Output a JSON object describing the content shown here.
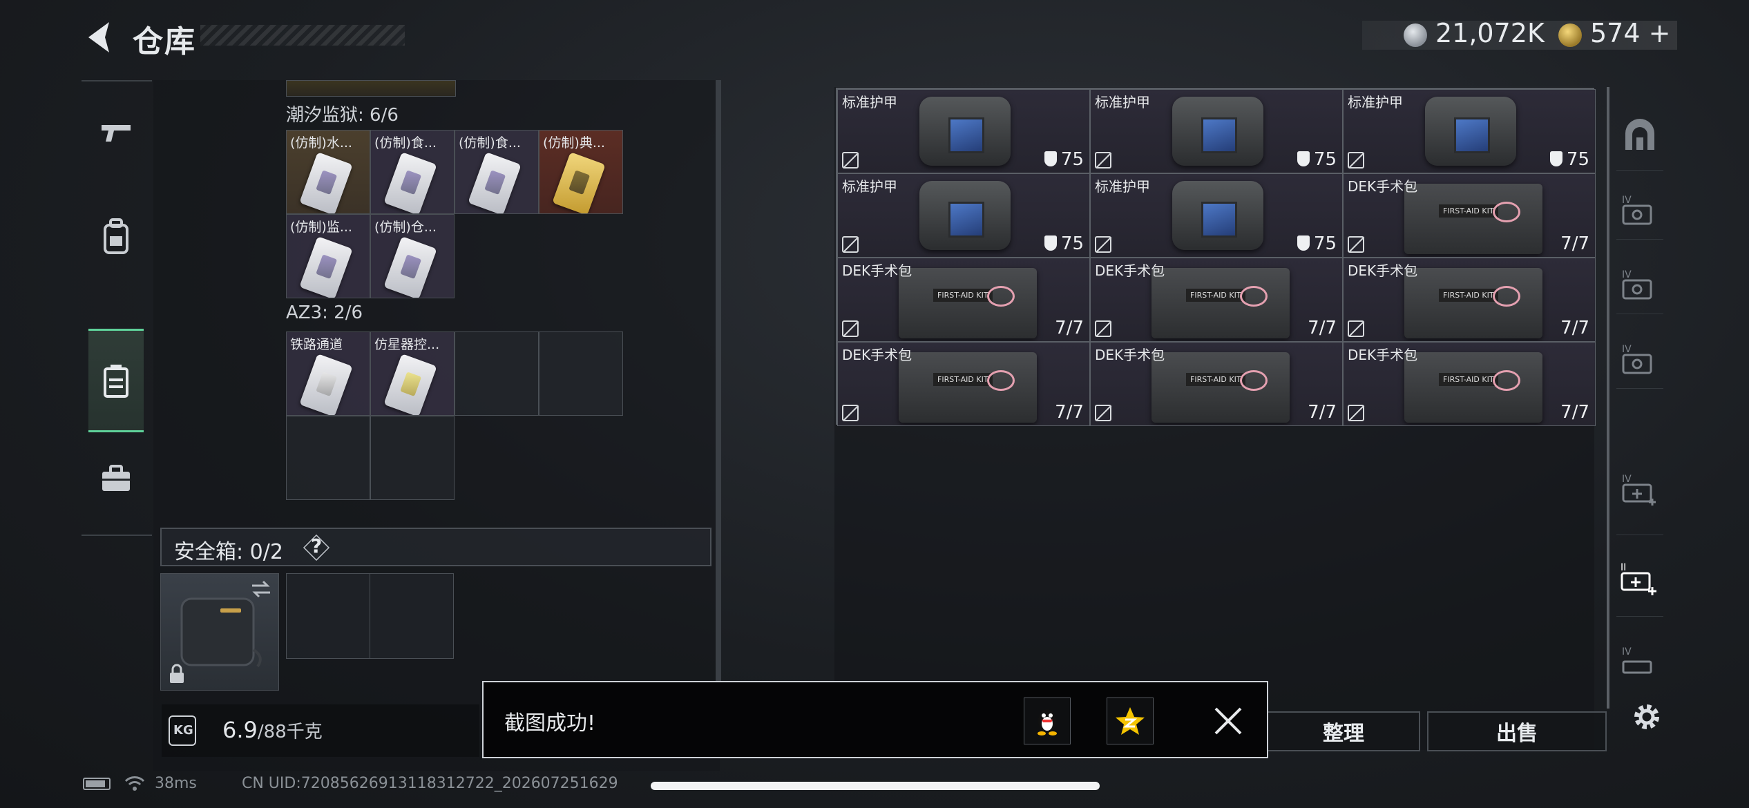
{
  "header": {
    "title": "仓库",
    "coin_value": "21,072K",
    "bond_value": "574",
    "bond_add": "+"
  },
  "left_nav": [
    "gun-icon",
    "backpack-icon",
    "chest-rig-icon",
    "toolbox-icon"
  ],
  "containers": [
    {
      "title": "潮汐监狱: 6/6",
      "items": [
        {
          "label": "(仿制)水...",
          "tone": "brown"
        },
        {
          "label": "(仿制)食...",
          "tone": "purple"
        },
        {
          "label": "(仿制)食...",
          "tone": "purple"
        },
        {
          "label": "(仿制)典...",
          "tone": "red"
        },
        {
          "label": "(仿制)监...",
          "tone": "purple"
        },
        {
          "label": "(仿制)仓...",
          "tone": "purple"
        }
      ]
    },
    {
      "title": "AZ3: 2/6",
      "items": [
        {
          "label": "铁路通道",
          "tone": "purple"
        },
        {
          "label": "仿星器控...",
          "tone": "purple"
        }
      ]
    }
  ],
  "safe_box": {
    "label": "安全箱: 0/2",
    "help": "?"
  },
  "weight": {
    "icon_label": "KG",
    "current": "6.9",
    "max": "/88千克"
  },
  "stash_items": [
    {
      "name": "标准护甲",
      "stat": "75",
      "kind": "armor"
    },
    {
      "name": "标准护甲",
      "stat": "75",
      "kind": "armor"
    },
    {
      "name": "标准护甲",
      "stat": "75",
      "kind": "armor"
    },
    {
      "name": "标准护甲",
      "stat": "75",
      "kind": "armor"
    },
    {
      "name": "标准护甲",
      "stat": "75",
      "kind": "armor"
    },
    {
      "name": "DEK手术包",
      "stat": "7/7",
      "kind": "kit"
    },
    {
      "name": "DEK手术包",
      "stat": "7/7",
      "kind": "kit"
    },
    {
      "name": "DEK手术包",
      "stat": "7/7",
      "kind": "kit"
    },
    {
      "name": "DEK手术包",
      "stat": "7/7",
      "kind": "kit"
    },
    {
      "name": "DEK手术包",
      "stat": "7/7",
      "kind": "kit"
    },
    {
      "name": "DEK手术包",
      "stat": "7/7",
      "kind": "kit"
    },
    {
      "name": "DEK手术包",
      "stat": "7/7",
      "kind": "kit"
    }
  ],
  "right_rail": [
    "stash-tab-icon",
    "IV",
    "IV",
    "IV",
    "IV",
    "II",
    "IV"
  ],
  "actions": {
    "sort": "整理",
    "sell": "出售"
  },
  "toast": {
    "message": "截图成功!"
  },
  "status_bar": {
    "ping": "38ms",
    "uid": "CN UID:72085626913118312722_202607251629"
  },
  "colors": {
    "accent_green": "#5fd29a",
    "gold": "#d4ae4a"
  }
}
